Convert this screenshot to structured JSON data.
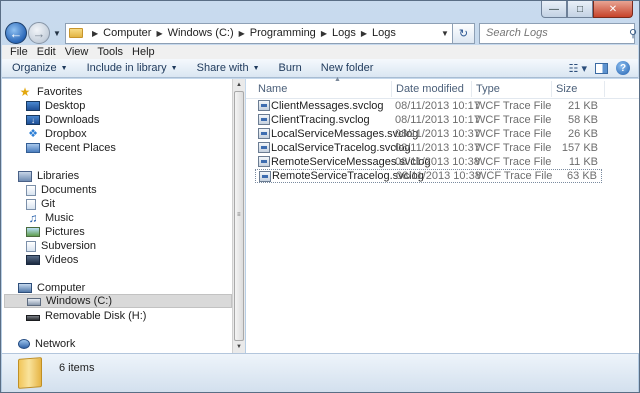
{
  "address": {
    "crumbs": [
      "Computer",
      "Windows (C:)",
      "Programming",
      "Logs",
      "Logs"
    ]
  },
  "search": {
    "placeholder": "Search Logs"
  },
  "menu": [
    "File",
    "Edit",
    "View",
    "Tools",
    "Help"
  ],
  "toolbar": {
    "organize": "Organize",
    "include": "Include in library",
    "share": "Share with",
    "burn": "Burn",
    "new_folder": "New folder"
  },
  "nav": {
    "favorites": "Favorites",
    "desktop": "Desktop",
    "downloads": "Downloads",
    "dropbox": "Dropbox",
    "recent": "Recent Places",
    "libraries": "Libraries",
    "documents": "Documents",
    "git": "Git",
    "music": "Music",
    "pictures": "Pictures",
    "subversion": "Subversion",
    "videos": "Videos",
    "computer": "Computer",
    "windows_c": "Windows (C:)",
    "removable": "Removable Disk (H:)",
    "network": "Network"
  },
  "columns": {
    "name": "Name",
    "date": "Date modified",
    "type": "Type",
    "size": "Size"
  },
  "files": [
    {
      "name": "ClientMessages.svclog",
      "date": "08/11/2013 10:17",
      "type": "WCF Trace File",
      "size": "21 KB"
    },
    {
      "name": "ClientTracing.svclog",
      "date": "08/11/2013 10:17",
      "type": "WCF Trace File",
      "size": "58 KB"
    },
    {
      "name": "LocalServiceMessages.svclog",
      "date": "08/11/2013 10:37",
      "type": "WCF Trace File",
      "size": "26 KB"
    },
    {
      "name": "LocalServiceTracelog.svclog",
      "date": "08/11/2013 10:37",
      "type": "WCF Trace File",
      "size": "157 KB"
    },
    {
      "name": "RemoteServiceMessages.svclog",
      "date": "08/11/2013 10:38",
      "type": "WCF Trace File",
      "size": "11 KB"
    },
    {
      "name": "RemoteServiceTracelog.svclog",
      "date": "08/11/2013 10:38",
      "type": "WCF Trace File",
      "size": "63 KB"
    }
  ],
  "status": {
    "item_count": "6 items"
  }
}
